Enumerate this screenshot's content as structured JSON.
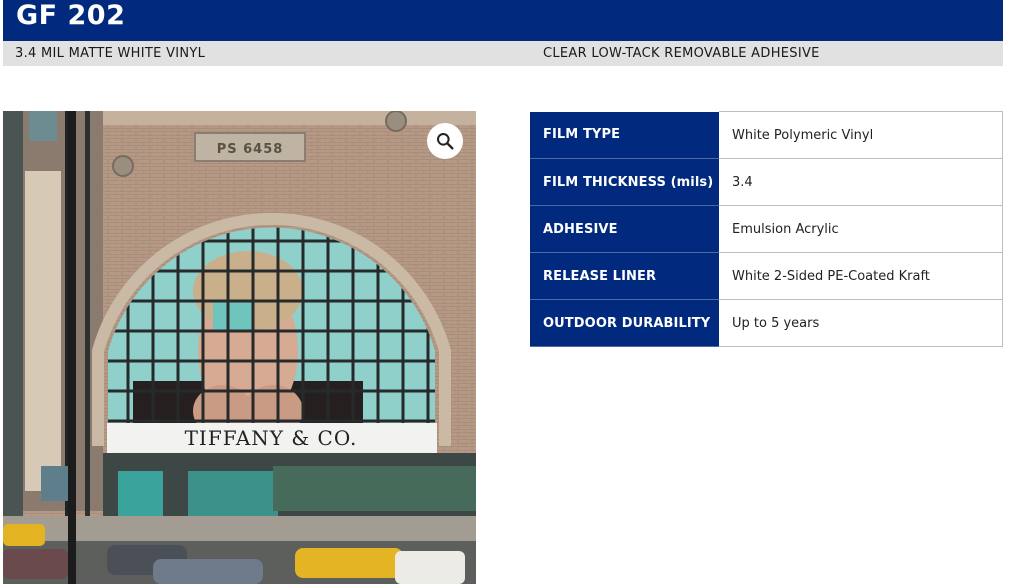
{
  "header": {
    "title": "GF 202",
    "subtitle_left": "3.4 MIL MATTE WHITE VINYL",
    "subtitle_right": "CLEAR LOW-TACK REMOVABLE ADHESIVE"
  },
  "photo": {
    "signage_text": "TIFFANY & CO.",
    "plaque_text": "PS 6458",
    "zoom_icon": "magnifier-icon"
  },
  "specs": [
    {
      "label": "FILM TYPE",
      "value": "White Polymeric Vinyl"
    },
    {
      "label": "FILM THICKNESS (mils)",
      "value": "3.4"
    },
    {
      "label": "ADHESIVE",
      "value": "Emulsion Acrylic"
    },
    {
      "label": "RELEASE LINER",
      "value": "White 2-Sided PE-Coated Kraft"
    },
    {
      "label": "OUTDOOR DURABILITY",
      "value": "Up to 5 years"
    }
  ],
  "colors": {
    "brand_navy": "#012a7e",
    "subtitle_bar": "#e1e1e1",
    "tiffany_blue": "#81d8d0"
  }
}
